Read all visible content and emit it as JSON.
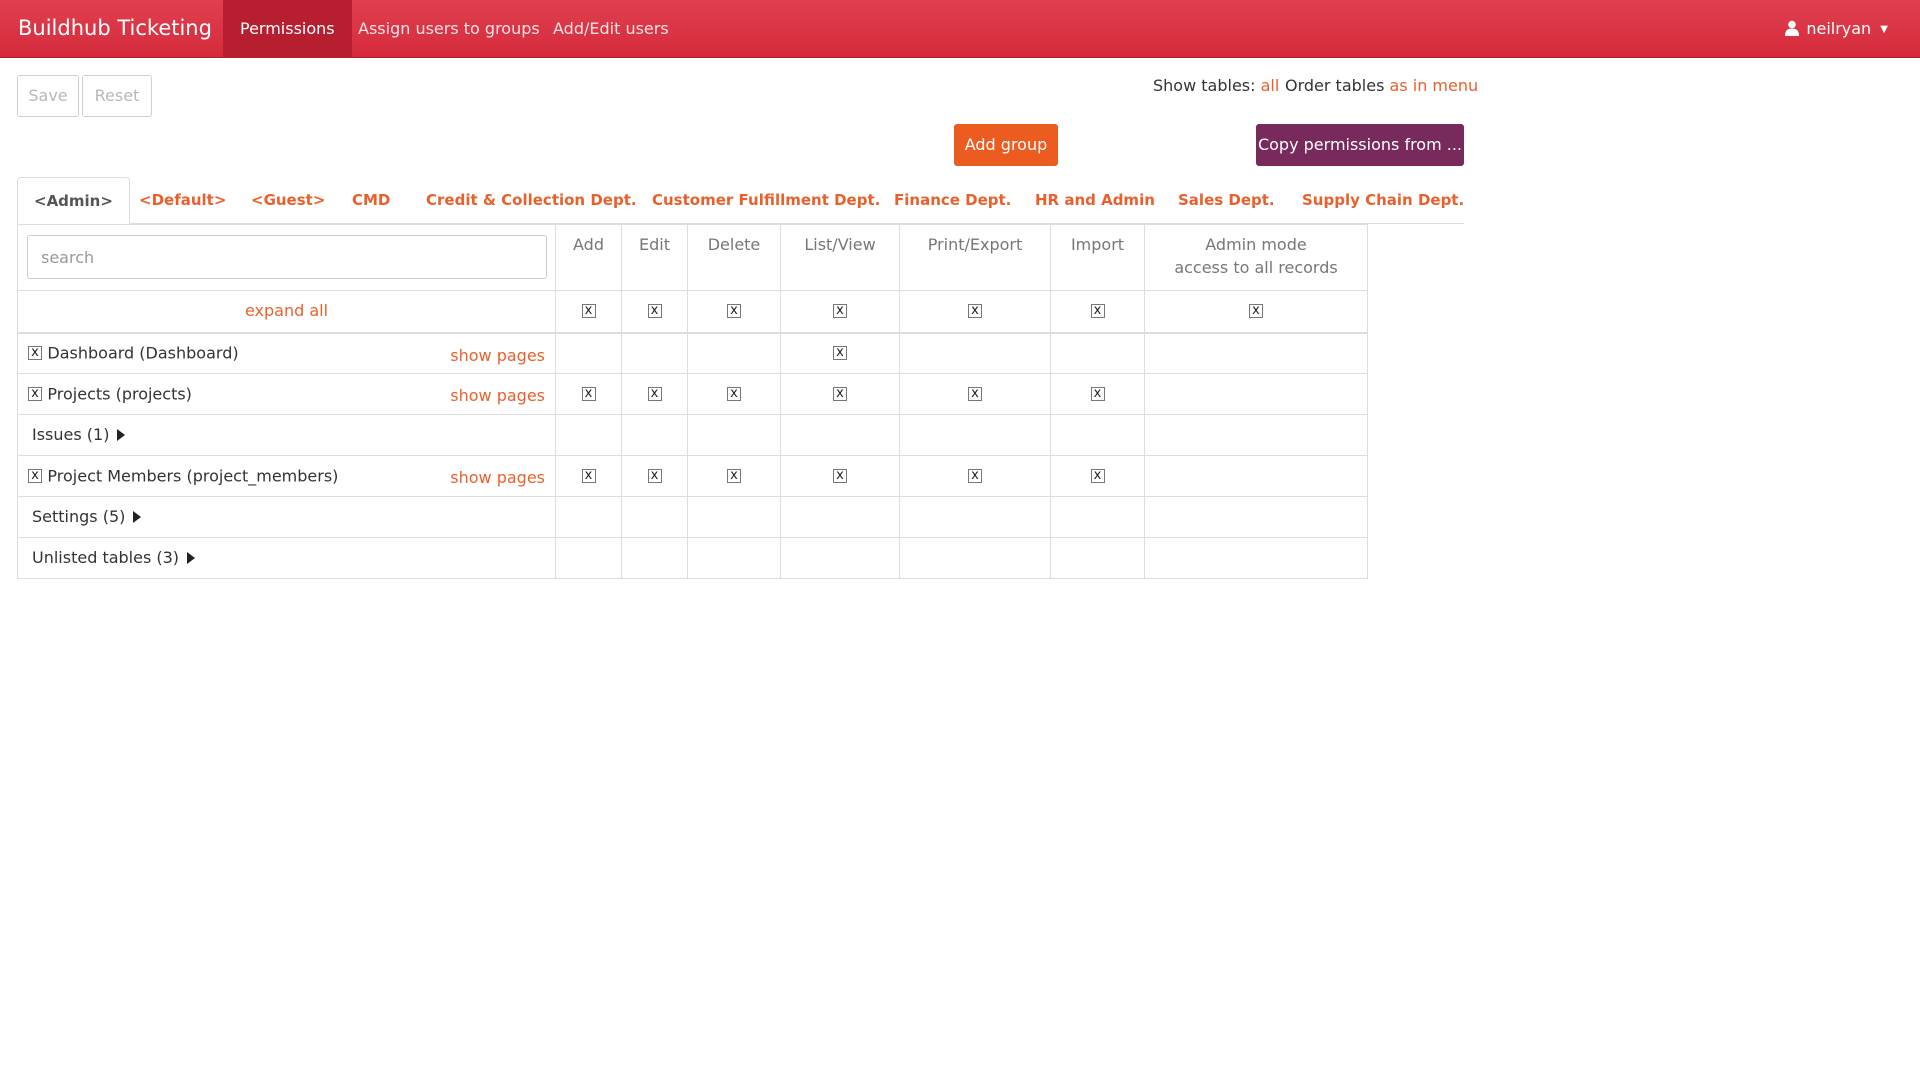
{
  "navbar": {
    "brand": "Buildhub Ticketing",
    "links": [
      "Permissions",
      "Assign users to groups",
      "Add/Edit users"
    ],
    "user": "neilryan"
  },
  "toolbar": {
    "save_label": "Save",
    "reset_label": "Reset",
    "show_tables_label": "Show tables:",
    "show_tables_value": "all",
    "order_tables_label": "Order tables",
    "order_tables_value": "as in menu",
    "add_group_label": "Add group",
    "copy_permissions_label": "Copy permissions from ..."
  },
  "colors": {
    "navbar": "#d52a3c",
    "accent_link": "#e8612c",
    "add_group": "#ec5c20",
    "copy_permissions": "#782a5c"
  },
  "tabs": [
    "<Admin>",
    "<Default>",
    "<Guest>",
    "CMD",
    "Credit & Collection Dept.",
    "Customer Fulfillment Dept.",
    "Finance Dept.",
    "HR and Admin",
    "Sales Dept.",
    "Supply Chain Dept."
  ],
  "active_tab": "<Admin>",
  "table": {
    "search_placeholder": "search",
    "expand_all": "expand all",
    "columns": [
      "Add",
      "Edit",
      "Delete",
      "List/View",
      "Print/Export",
      "Import"
    ],
    "admin_col_line1": "Admin mode",
    "admin_col_line2": "access to all records",
    "checkbox_mark": "x",
    "rows": [
      {
        "label": "Dashboard (Dashboard)",
        "show_pages": "show pages"
      },
      {
        "label": "Projects (projects)",
        "show_pages": "show pages"
      },
      {
        "label": "Issues (1)"
      },
      {
        "label": "Project Members (project_members)",
        "show_pages": "show pages"
      },
      {
        "label": "Settings (5)"
      },
      {
        "label": "Unlisted tables (3)"
      }
    ]
  }
}
